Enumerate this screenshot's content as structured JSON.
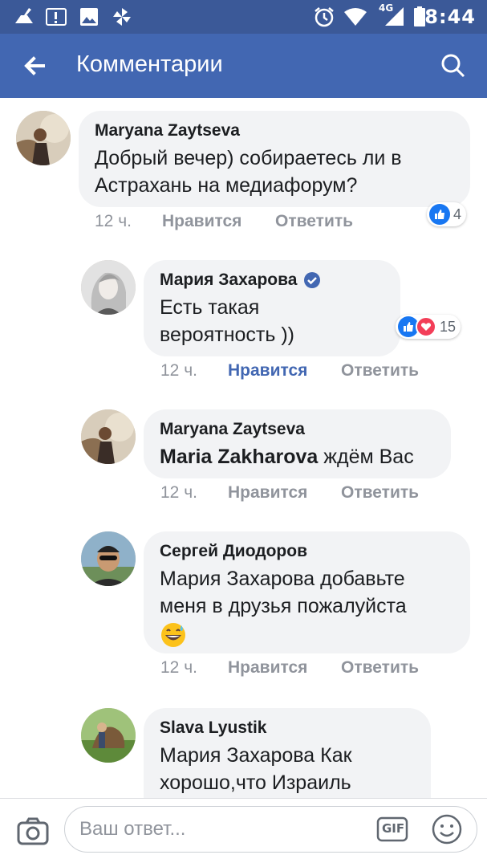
{
  "status_bar": {
    "time": "8:44",
    "network": "4G",
    "icons": [
      "cleaner-icon",
      "alert-image-icon",
      "gallery-icon",
      "pinwheel-icon",
      "alarm-icon",
      "wifi-icon",
      "signal-icon",
      "battery-icon"
    ]
  },
  "header": {
    "title": "Комментарии",
    "back_icon": "arrow-left-icon",
    "search_icon": "search-icon"
  },
  "comments": [
    {
      "author": "Maryana Zaytseva",
      "text": "Добрый вечер) собираетесь ли в Астрахань на медиафорум?",
      "time": "12 ч.",
      "like_label": "Нравится",
      "reply_label": "Ответить",
      "like_active": false,
      "reactions": {
        "types": [
          "like"
        ],
        "count": "4"
      }
    },
    {
      "author": "Мария Захарова",
      "verified": true,
      "text": "Есть такая вероятность ))",
      "time": "12 ч.",
      "like_label": "Нравится",
      "reply_label": "Ответить",
      "like_active": true,
      "reactions": {
        "types": [
          "like",
          "love"
        ],
        "count": "15"
      }
    },
    {
      "author": "Maryana Zaytseva",
      "mention": "Maria Zakharova",
      "text": " ждём Вас",
      "time": "12 ч.",
      "like_label": "Нравится",
      "reply_label": "Ответить",
      "like_active": false
    },
    {
      "author": "Сергей Диодоров",
      "text": "Мария Захарова добавьте меня в друзья пожалуйста",
      "emoji": "grinning-sweat-emoji",
      "time": "12 ч.",
      "like_label": "Нравится",
      "reply_label": "Ответить",
      "like_active": false
    },
    {
      "author": "Slava Lyustik",
      "text": "Мария Захарова Как хорошо,что Израиль"
    }
  ],
  "composer": {
    "placeholder": "Ваш ответ...",
    "gif_label": "GIF",
    "camera_icon": "camera-icon",
    "emoji_icon": "smiley-icon"
  },
  "colors": {
    "status_bar": "#3b5998",
    "app_bar": "#4267b2",
    "bubble": "#f2f3f5",
    "active_like": "#4267b2",
    "meta_text": "#90949c"
  }
}
